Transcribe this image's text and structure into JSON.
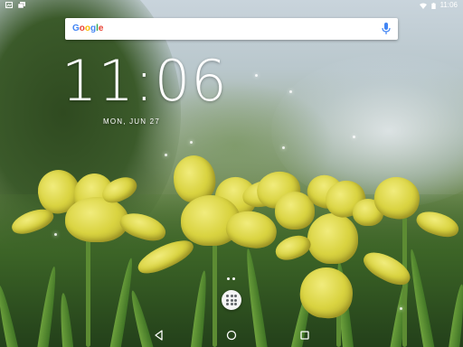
{
  "status_bar": {
    "time": "11:06",
    "icons_left": [
      "screenshot-icon",
      "files-icon"
    ],
    "icons_right": [
      "wifi-icon",
      "battery-icon"
    ]
  },
  "search": {
    "logo": "Google",
    "mic_icon": "mic-icon"
  },
  "clock_widget": {
    "time": "11:06",
    "date": "MON, JUN 27"
  },
  "launcher": {
    "page_count": 2,
    "app_drawer_icon": "apps-grid-icon"
  },
  "nav_bar": {
    "buttons": [
      "back-icon",
      "home-icon",
      "recents-icon"
    ]
  },
  "colors": {
    "google_blue": "#4285F4",
    "google_red": "#EA4335",
    "google_yellow": "#FBBC05",
    "google_green": "#34A853",
    "mic": "#4285F4"
  }
}
